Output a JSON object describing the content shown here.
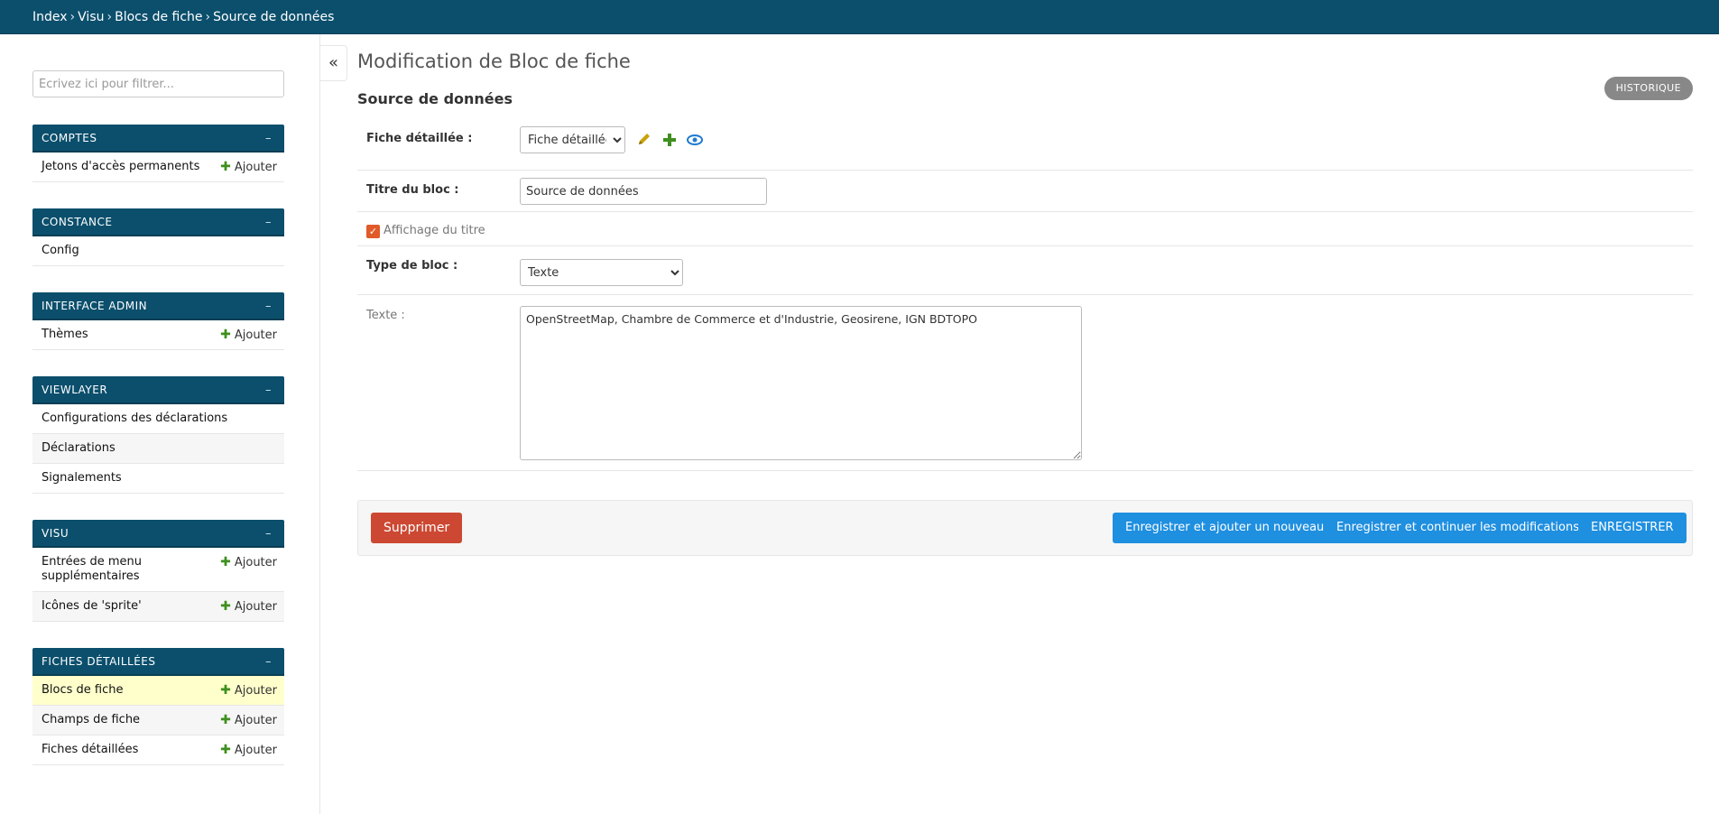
{
  "breadcrumbs": [
    "Index",
    "Visu",
    "Blocs de fiche",
    "Source de données"
  ],
  "breadcrumb_separator": "›",
  "sidebar": {
    "filter_placeholder": "Écrivez ici pour filtrer...",
    "add_label": "Ajouter",
    "collapse_symbol": "–",
    "modules": [
      {
        "title": "COMPTES",
        "items": [
          {
            "label": "Jetons d'accès permanents"
          }
        ]
      },
      {
        "title": "CONSTANCE",
        "items": [
          {
            "label": "Config"
          }
        ]
      },
      {
        "title": "INTERFACE ADMIN",
        "items": [
          {
            "label": "Thèmes"
          }
        ]
      },
      {
        "title": "VIEWLAYER",
        "items": [
          {
            "label": "Configurations des déclarations"
          },
          {
            "label": "Déclarations"
          },
          {
            "label": "Signalements"
          }
        ]
      },
      {
        "title": "VISU",
        "items": [
          {
            "label": "Entrées de menu supplémentaires"
          },
          {
            "label": "Icônes de 'sprite'"
          }
        ]
      },
      {
        "title": "FICHES DÉTAILLÉES",
        "items": [
          {
            "label": "Blocs de fiche"
          },
          {
            "label": "Champs de fiche"
          },
          {
            "label": "Fiches détaillées"
          }
        ]
      }
    ]
  },
  "nav_toggle_symbol": "«",
  "main": {
    "title": "Modification de Bloc de fiche",
    "history_button": "HISTORIQUE",
    "section_title": "Source de données",
    "fields": {
      "fiche_label": "Fiche détaillée :",
      "fiche_value": "Fiche détaillée",
      "titre_label": "Titre du bloc :",
      "titre_value": "Source de données",
      "affichage_label": "Affichage du titre",
      "affichage_checked": true,
      "type_label": "Type de bloc :",
      "type_value": "Texte",
      "texte_label": "Texte :",
      "texte_value": "OpenStreetMap, Chambre de Commerce et d'Industrie, Geosirene, IGN BDTOPO"
    },
    "actions": {
      "delete": "Supprimer",
      "save_add": "Enregistrer et ajouter un nouveau",
      "save_continue": "Enregistrer et continuer les modifications",
      "save": "ENREGISTRER"
    }
  },
  "colors": {
    "header": "#0b4f6c",
    "primary_button": "#1f8fe0",
    "danger_button": "#cc4833",
    "active_row": "#ffffcc",
    "add_plus": "#3f8f1f",
    "edit_icon": "#c9a20a",
    "view_icon": "#1f7ad0",
    "checkbox": "#e05a2a"
  },
  "icons": [
    "pencil-icon",
    "plus-icon",
    "eye-icon",
    "chevron-down-icon"
  ]
}
